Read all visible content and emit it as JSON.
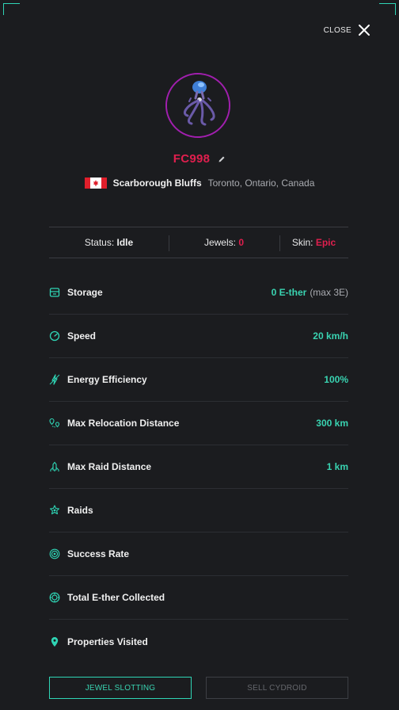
{
  "header": {
    "close_label": "CLOSE"
  },
  "profile": {
    "name": "FC998",
    "location_main": "Scarborough Bluffs",
    "location_sub": "Toronto, Ontario, Canada"
  },
  "status": {
    "status_label": "Status:",
    "status_value": "Idle",
    "jewels_label": "Jewels:",
    "jewels_value": "0",
    "skin_label": "Skin:",
    "skin_value": "Epic"
  },
  "stats": [
    {
      "label": "Storage",
      "value": "0 E-ther",
      "extra": "(max 3E)",
      "icon": "storage-icon"
    },
    {
      "label": "Speed",
      "value": "20 km/h",
      "extra": "",
      "icon": "speedometer-icon"
    },
    {
      "label": "Energy Efficiency",
      "value": "100%",
      "extra": "",
      "icon": "energy-icon"
    },
    {
      "label": "Max Relocation Distance",
      "value": "300 km",
      "extra": "",
      "icon": "relocation-icon"
    },
    {
      "label": "Max Raid Distance",
      "value": "1 km",
      "extra": "",
      "icon": "raid-distance-icon"
    },
    {
      "label": "Raids",
      "value": "",
      "extra": "",
      "icon": "raids-icon"
    },
    {
      "label": "Success Rate",
      "value": "",
      "extra": "",
      "icon": "target-icon"
    },
    {
      "label": "Total E-ther Collected",
      "value": "",
      "extra": "",
      "icon": "ether-coin-icon"
    },
    {
      "label": "Properties Visited",
      "value": "",
      "extra": "",
      "icon": "map-pin-icon"
    }
  ],
  "actions": {
    "primary_label": "JEWEL SLOTTING",
    "secondary_label": "SELL CYDROID"
  },
  "colors": {
    "accent": "#2fd5b5",
    "danger": "#e01f4e",
    "avatar_ring": "#a11fae",
    "background": "#1b1c1f"
  }
}
